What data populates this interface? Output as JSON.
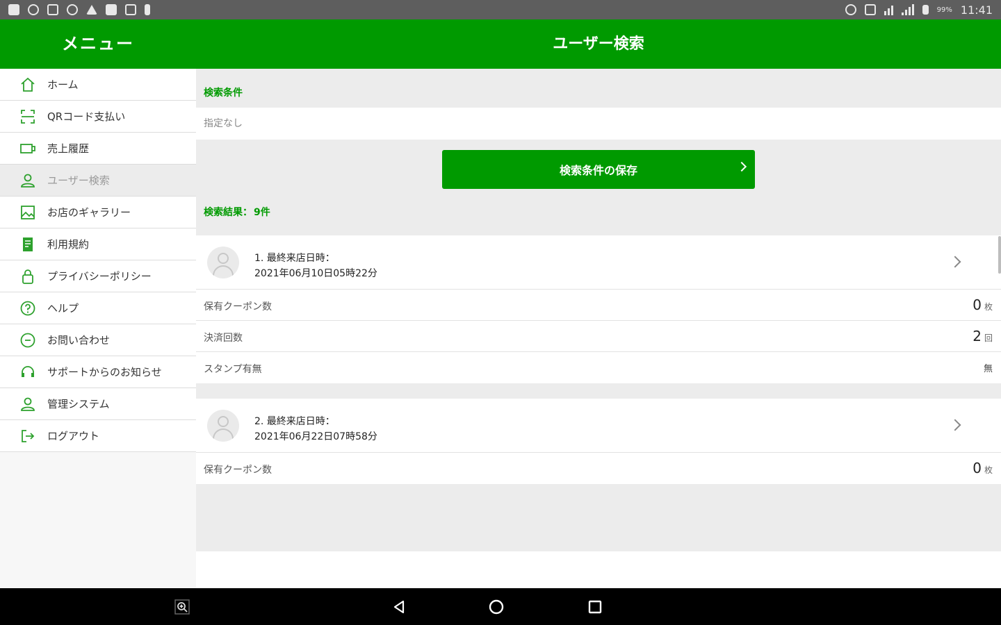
{
  "status_bar": {
    "time": "11:41",
    "battery": "99%"
  },
  "header": {
    "menu_title": "メニュー",
    "page_title": "ユーザー検索"
  },
  "sidebar": {
    "items": [
      {
        "label": "ホーム",
        "icon": "home-icon"
      },
      {
        "label": "QRコード支払い",
        "icon": "qr-scan-icon"
      },
      {
        "label": "売上履歴",
        "icon": "sales-history-icon"
      },
      {
        "label": "ユーザー検索",
        "icon": "user-icon",
        "active": true
      },
      {
        "label": "お店のギャラリー",
        "icon": "gallery-icon"
      },
      {
        "label": "利用規約",
        "icon": "document-icon"
      },
      {
        "label": "プライバシーポリシー",
        "icon": "lock-icon"
      },
      {
        "label": "ヘルプ",
        "icon": "help-icon"
      },
      {
        "label": "お問い合わせ",
        "icon": "chat-icon"
      },
      {
        "label": "サポートからのお知らせ",
        "icon": "headset-icon"
      },
      {
        "label": "管理システム",
        "icon": "admin-user-icon"
      },
      {
        "label": "ログアウト",
        "icon": "logout-icon"
      }
    ]
  },
  "search": {
    "section_title": "検索条件",
    "condition_value": "指定なし",
    "save_button_label": "検索条件の保存",
    "result_label": "検索結果：",
    "result_count": "9件"
  },
  "results": [
    {
      "title": "1. 最終来店日時：",
      "date": "2021年06月10日05時22分",
      "rows": [
        {
          "label": "保有クーポン数",
          "value": "0",
          "unit": "枚"
        },
        {
          "label": "決済回数",
          "value": "2",
          "unit": "回"
        },
        {
          "label": "スタンプ有無",
          "value": "無",
          "unit": ""
        }
      ]
    },
    {
      "title": "2. 最終来店日時：",
      "date": "2021年06月22日07時58分",
      "rows": [
        {
          "label": "保有クーポン数",
          "value": "0",
          "unit": "枚"
        }
      ]
    }
  ],
  "colors": {
    "brand_green": "#009a00",
    "status_bar": "#5e5e5e",
    "nav_bar": "#000000"
  },
  "nav_bar": {
    "buttons": [
      "zoom-icon",
      "back-icon",
      "home-circle-icon",
      "recent-apps-icon"
    ]
  }
}
